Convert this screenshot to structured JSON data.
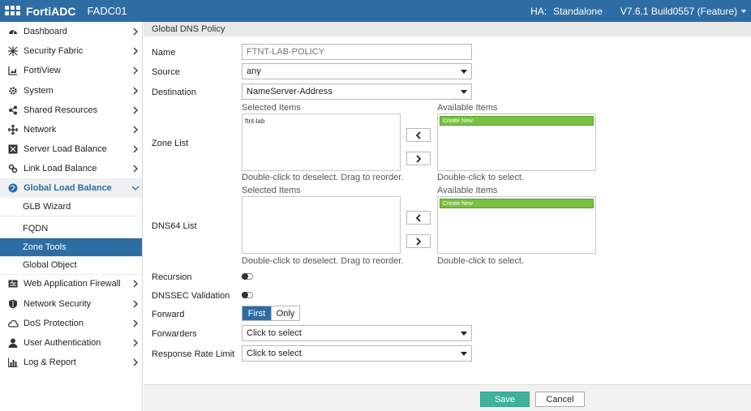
{
  "topbar": {
    "brand": "FortiADC",
    "host": "FADC01",
    "ha_label": "HA:",
    "ha_value": "Standalone",
    "version": "V7.6.1 Build0557 (Feature)"
  },
  "sidebar": {
    "items": [
      {
        "label": "Dashboard",
        "icon": "dashboard-icon"
      },
      {
        "label": "Security Fabric",
        "icon": "fabric-icon"
      },
      {
        "label": "FortiView",
        "icon": "chart-icon"
      },
      {
        "label": "System",
        "icon": "gear-icon"
      },
      {
        "label": "Shared Resources",
        "icon": "share-icon"
      },
      {
        "label": "Network",
        "icon": "network-icon"
      },
      {
        "label": "Server Load Balance",
        "icon": "server-icon"
      },
      {
        "label": "Link Load Balance",
        "icon": "link-icon"
      },
      {
        "label": "Global Load Balance",
        "icon": "globe-icon"
      }
    ],
    "glb_children": [
      {
        "label": "GLB Wizard"
      },
      {
        "label": "FQDN"
      },
      {
        "label": "Zone Tools"
      },
      {
        "label": "Global Object"
      }
    ],
    "items_after": [
      {
        "label": "Web Application Firewall",
        "icon": "waf-icon"
      },
      {
        "label": "Network Security",
        "icon": "shield-icon"
      },
      {
        "label": "DoS Protection",
        "icon": "cloud-icon"
      },
      {
        "label": "User Authentication",
        "icon": "user-icon"
      },
      {
        "label": "Log & Report",
        "icon": "report-icon"
      }
    ]
  },
  "page": {
    "title": "Global DNS Policy"
  },
  "form": {
    "name_label": "Name",
    "name_placeholder": "FTNT-LAB-POLICY",
    "source_label": "Source",
    "source_value": "any",
    "destination_label": "Destination",
    "destination_value": "NameServer-Address",
    "zone_list_label": "Zone List",
    "zone_selected_caption": "Selected Items",
    "zone_available_caption": "Available Items",
    "zone_selected_items": [
      "ftnt-lab"
    ],
    "zone_available_items": [
      "Create New"
    ],
    "zone_selected_hint": "Double-click to deselect. Drag to reorder.",
    "zone_available_hint": "Double-click to select.",
    "dns64_list_label": "DNS64 List",
    "dns64_selected_caption": "Selected Items",
    "dns64_available_caption": "Available Items",
    "dns64_available_items": [
      "Create New"
    ],
    "dns64_selected_hint": "Double-click to deselect. Drag to reorder.",
    "dns64_available_hint": "Double-click to select.",
    "recursion_label": "Recursion",
    "dnssec_label": "DNSSEC Validation",
    "forward_label": "Forward",
    "forward_options": [
      "First",
      "Only"
    ],
    "forward_selected": "First",
    "forwarders_label": "Forwarders",
    "forwarders_value": "Click to select",
    "rrl_label": "Response Rate Limit",
    "rrl_value": "Click to select"
  },
  "footer": {
    "save_label": "Save",
    "cancel_label": "Cancel"
  },
  "colors": {
    "topbar": "#2e6da4",
    "selected_nav": "#2e6da4",
    "available_item": "#7ac143",
    "save_button": "#3fb39a"
  }
}
